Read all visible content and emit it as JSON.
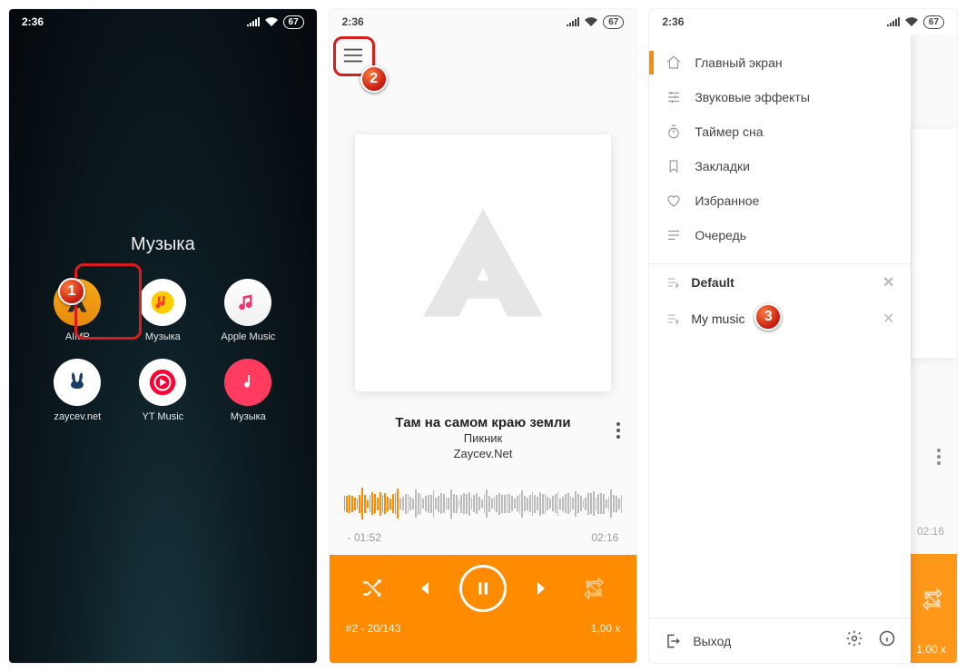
{
  "status": {
    "time": "2:36",
    "battery": "67"
  },
  "screen1": {
    "folder_title": "Музыка",
    "apps": [
      "AIMP",
      "Музыка",
      "Apple Music",
      "zaycev.net",
      "YT Music",
      "Музыка"
    ]
  },
  "screen2": {
    "track_title": "Там на самом краю земли",
    "artist": "Пикник",
    "album": "Zaycev.Net",
    "elapsed": "- 01:52",
    "total": "02:16",
    "queue_info": "#2  -  20/143",
    "speed": "1,00 x"
  },
  "screen3": {
    "nav": {
      "home": "Главный экран",
      "eq": "Звуковые эффекты",
      "timer": "Таймер сна",
      "bookmarks": "Закладки",
      "fav": "Избранное",
      "queue": "Очередь"
    },
    "playlists": {
      "default": "Default",
      "mymusic": "My music"
    },
    "exit": "Выход",
    "ghost_time": "02:16",
    "ghost_rate": "1,00 x"
  },
  "badges": {
    "b1": "1",
    "b2": "2",
    "b3": "3"
  }
}
